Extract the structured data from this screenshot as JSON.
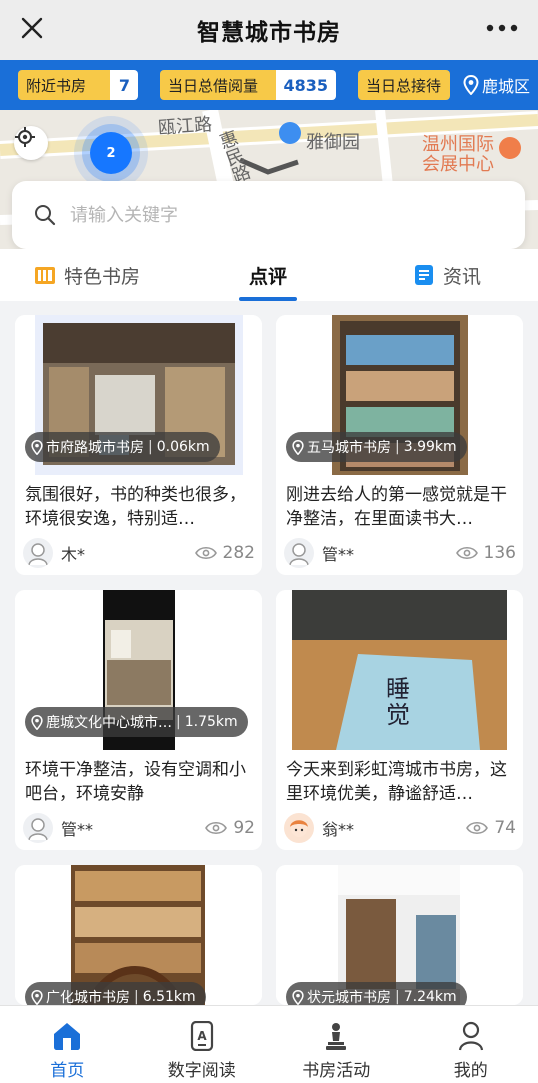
{
  "header": {
    "title": "智慧城市书房"
  },
  "stats": {
    "nearby_label": "附近书房",
    "nearby_value": "7",
    "borrow_label": "当日总借阅量",
    "borrow_value": "4835",
    "visit_label": "当日总接待",
    "district": "鹿城区"
  },
  "map": {
    "labels": [
      "瓯江路",
      "惠民路",
      "雅御园",
      "温州国际",
      "会展中心"
    ],
    "cluster_count": "2"
  },
  "search": {
    "placeholder": "请输入关键字"
  },
  "tabs": [
    {
      "label": "特色书房"
    },
    {
      "label": "点评"
    },
    {
      "label": "资讯"
    }
  ],
  "cards": [
    {
      "place": "市府路城市书房",
      "distance": "0.06km",
      "desc": "氛围很好，书的种类也很多，环境很安逸，特别适…",
      "user": "木*",
      "views": "282"
    },
    {
      "place": "五马城市书房",
      "distance": "3.99km",
      "desc": "刚进去给人的第一感觉就是干净整洁，在里面读书大…",
      "user": "管**",
      "views": "136"
    },
    {
      "place": "鹿城文化中心城市…",
      "distance": "1.75km",
      "desc": "环境干净整洁，设有空调和小吧台，环境安静",
      "user": "管**",
      "views": "92"
    },
    {
      "place": "",
      "distance": "",
      "desc": "今天来到彩虹湾城市书房，这里环境优美，静谧舒适…",
      "user": "翁**",
      "views": "74",
      "book_text": "睡觉"
    },
    {
      "place": "广化城市书房",
      "distance": "6.51km",
      "desc": "",
      "user": "",
      "views": ""
    },
    {
      "place": "状元城市书房",
      "distance": "7.24km",
      "desc": "",
      "user": "",
      "views": ""
    }
  ],
  "nav": [
    {
      "label": "首页"
    },
    {
      "label": "数字阅读"
    },
    {
      "label": "书房活动"
    },
    {
      "label": "我的"
    }
  ],
  "colors": {
    "primary": "#1a6fd8",
    "stat_yellow": "#f7c948"
  },
  "icons": [
    "close-icon",
    "more-icon",
    "location-pin-icon",
    "locate-icon",
    "search-icon",
    "bookshelf-icon",
    "news-icon",
    "eye-icon",
    "home-icon",
    "reader-icon",
    "chess-icon",
    "user-icon"
  ]
}
